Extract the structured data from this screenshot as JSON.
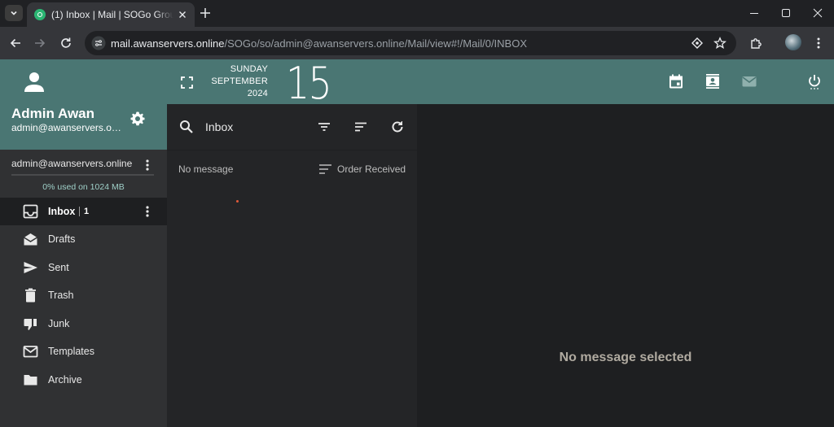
{
  "browser": {
    "tab_title": "(1) Inbox | Mail | SOGo Groupware",
    "url_host": "mail.awanservers.online",
    "url_path": "/SOGo/so/admin@awanservers.online/Mail/view#!/Mail/0/INBOX"
  },
  "user": {
    "name": "Admin Awan",
    "email": "admin@awanservers.online"
  },
  "account": {
    "name": "admin@awanservers.online",
    "quota_text": "0% used on 1024 MB",
    "quota_fraction": 0
  },
  "folders": [
    {
      "label": "Inbox",
      "icon": "inbox-icon",
      "unread": "1",
      "active": true
    },
    {
      "label": "Drafts",
      "icon": "drafts-icon"
    },
    {
      "label": "Sent",
      "icon": "sent-icon"
    },
    {
      "label": "Trash",
      "icon": "trash-icon"
    },
    {
      "label": "Junk",
      "icon": "junk-icon"
    },
    {
      "label": "Templates",
      "icon": "templates-icon"
    },
    {
      "label": "Archive",
      "icon": "archive-icon"
    }
  ],
  "date": {
    "day_name": "SUNDAY",
    "month": "SEPTEMBER",
    "year": "2024",
    "day": "15"
  },
  "message_list": {
    "folder_title": "Inbox",
    "empty_text": "No message",
    "sort_label": "Order Received"
  },
  "viewer": {
    "empty_text": "No message selected"
  },
  "colors": {
    "accent": "#4a7673",
    "sidebar": "#303133",
    "list_bg": "#242527",
    "viewer_bg": "#1e1f21"
  }
}
